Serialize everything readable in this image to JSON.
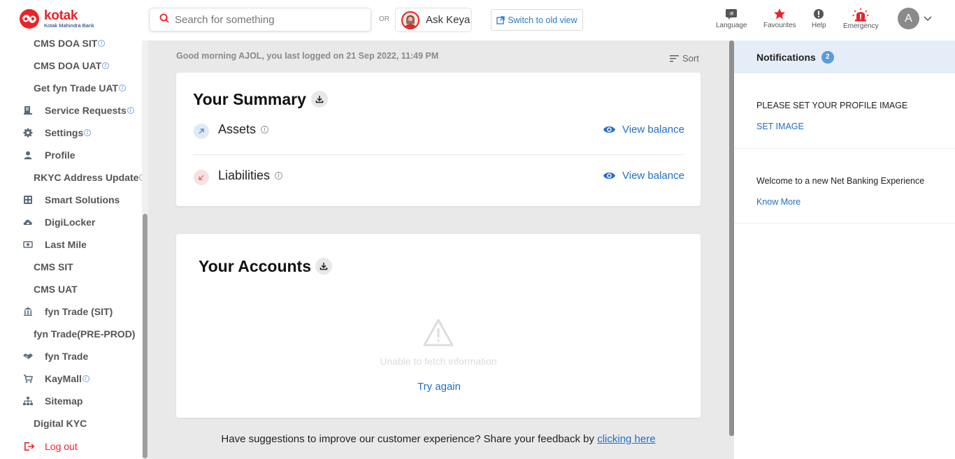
{
  "header": {
    "logo_title": "kotak",
    "logo_subtitle": "Kotak Mahindra Bank",
    "search_placeholder": "Search for something",
    "or_label": "OR",
    "ask_label": "Ask Keya",
    "switch_label": "Switch to old view",
    "icons": [
      {
        "name": "language-icon",
        "label": "Language"
      },
      {
        "name": "favourites-icon",
        "label": "Favourites"
      },
      {
        "name": "help-icon",
        "label": "Help"
      },
      {
        "name": "emergency-icon",
        "label": "Emergency"
      }
    ],
    "avatar_initial": "A"
  },
  "sidebar": {
    "items": [
      {
        "label": "CMS DOA SIT",
        "info": true,
        "icon": null
      },
      {
        "label": "CMS DOA UAT",
        "info": true,
        "icon": null
      },
      {
        "label": "Get fyn Trade UAT",
        "info": true,
        "icon": null
      },
      {
        "label": "Service Requests",
        "info": true,
        "icon": "service-requests-icon"
      },
      {
        "label": "Settings",
        "info": true,
        "icon": "gear-icon"
      },
      {
        "label": "Profile",
        "info": false,
        "icon": "profile-icon"
      },
      {
        "label": "RKYC Address Update",
        "info": true,
        "icon": null
      },
      {
        "label": "Smart Solutions",
        "info": false,
        "icon": "smart-solutions-icon"
      },
      {
        "label": "DigiLocker",
        "info": false,
        "icon": "digilocker-icon"
      },
      {
        "label": "Last Mile",
        "info": false,
        "icon": "last-mile-icon"
      },
      {
        "label": "CMS SIT",
        "info": false,
        "icon": null
      },
      {
        "label": "CMS UAT",
        "info": false,
        "icon": null
      },
      {
        "label": "fyn Trade (SIT)",
        "info": false,
        "icon": "bank-icon"
      },
      {
        "label": "fyn Trade(PRE-PROD)",
        "info": false,
        "icon": null
      },
      {
        "label": "fyn Trade",
        "info": false,
        "icon": "handshake-icon"
      },
      {
        "label": "KayMall",
        "info": true,
        "icon": "cart-icon"
      },
      {
        "label": "Sitemap",
        "info": false,
        "icon": "sitemap-icon"
      },
      {
        "label": "Digital KYC",
        "info": false,
        "icon": null
      },
      {
        "label": "Log out",
        "info": false,
        "icon": "logout-icon"
      }
    ],
    "info_glyph": "i"
  },
  "main": {
    "greeting": "Good morning AJOL, you last logged on 21 Sep 2022, 11:49 PM",
    "sort_label": "Sort",
    "summary": {
      "title": "Your Summary",
      "assets_label": "Assets",
      "liabilities_label": "Liabilities",
      "view_balance": "View balance"
    },
    "accounts": {
      "title": "Your Accounts",
      "error_text": "Unable to fetch information",
      "retry_label": "Try again"
    },
    "feedback": {
      "text": "Have suggestions to improve our customer experience? Share your feedback by ",
      "link": "clicking here"
    }
  },
  "notifications": {
    "title": "Notifications",
    "count": "2",
    "items": [
      {
        "text": "PLEASE SET YOUR PROFILE IMAGE",
        "link": "SET IMAGE"
      },
      {
        "text": "Welcome to a new Net Banking Experience",
        "link": "Know More"
      }
    ]
  },
  "colors": {
    "brand_red": "#ec2227",
    "link_blue": "#1f6fc5",
    "notif_badge": "#5b9bd8"
  }
}
